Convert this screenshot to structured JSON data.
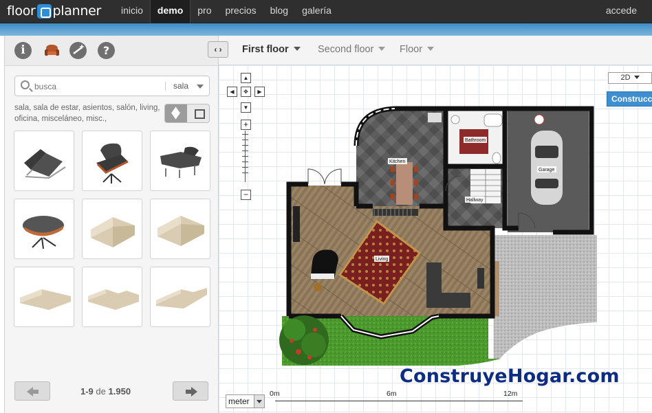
{
  "app": {
    "logo_left": "floor",
    "logo_right": "planner",
    "nav": [
      "inicio",
      "demo",
      "pro",
      "precios",
      "blog",
      "galería"
    ],
    "active_nav": "demo",
    "account_link": "accede"
  },
  "left_panel": {
    "tools": [
      "info-icon",
      "furniture-icon",
      "wand-icon",
      "help-icon"
    ],
    "search": {
      "placeholder": "busca",
      "category": "sala"
    },
    "tags": "sala, sala de estar, asientos, salón, living, oficina, misceláneo, misc.,",
    "view_modes": [
      "3d-view",
      "2d-view"
    ],
    "items": [
      "barcelona-chair",
      "lounge-chair",
      "wide-lounge-chair",
      "ottoman",
      "armchair",
      "sofa",
      "long-sofa",
      "corner-sofa",
      "l-sofa"
    ],
    "pager": {
      "range": "1-9",
      "of": "de",
      "total": "1.950"
    }
  },
  "toolbar": {
    "collapse_label": "‹ ›",
    "floors": [
      {
        "label": "First floor",
        "active": true
      },
      {
        "label": "Second floor",
        "active": false
      },
      {
        "label": "Floor",
        "active": false
      }
    ]
  },
  "canvas": {
    "view_mode": "2D",
    "construct_button": "Construcción",
    "rooms": [
      "Kitchen",
      "Bathroom",
      "Hallway",
      "Garage",
      "Living"
    ],
    "unit": "meter",
    "scale": [
      "0m",
      "6m",
      "12m"
    ],
    "watermark": "ConstruyeHogar.com"
  },
  "colors": {
    "topbar": "#2f2f2f",
    "accent_blue": "#3d8fd1",
    "wall": "#111111",
    "garden_green": "#4c9a2e",
    "tile_grey": "#5a5a5a"
  }
}
